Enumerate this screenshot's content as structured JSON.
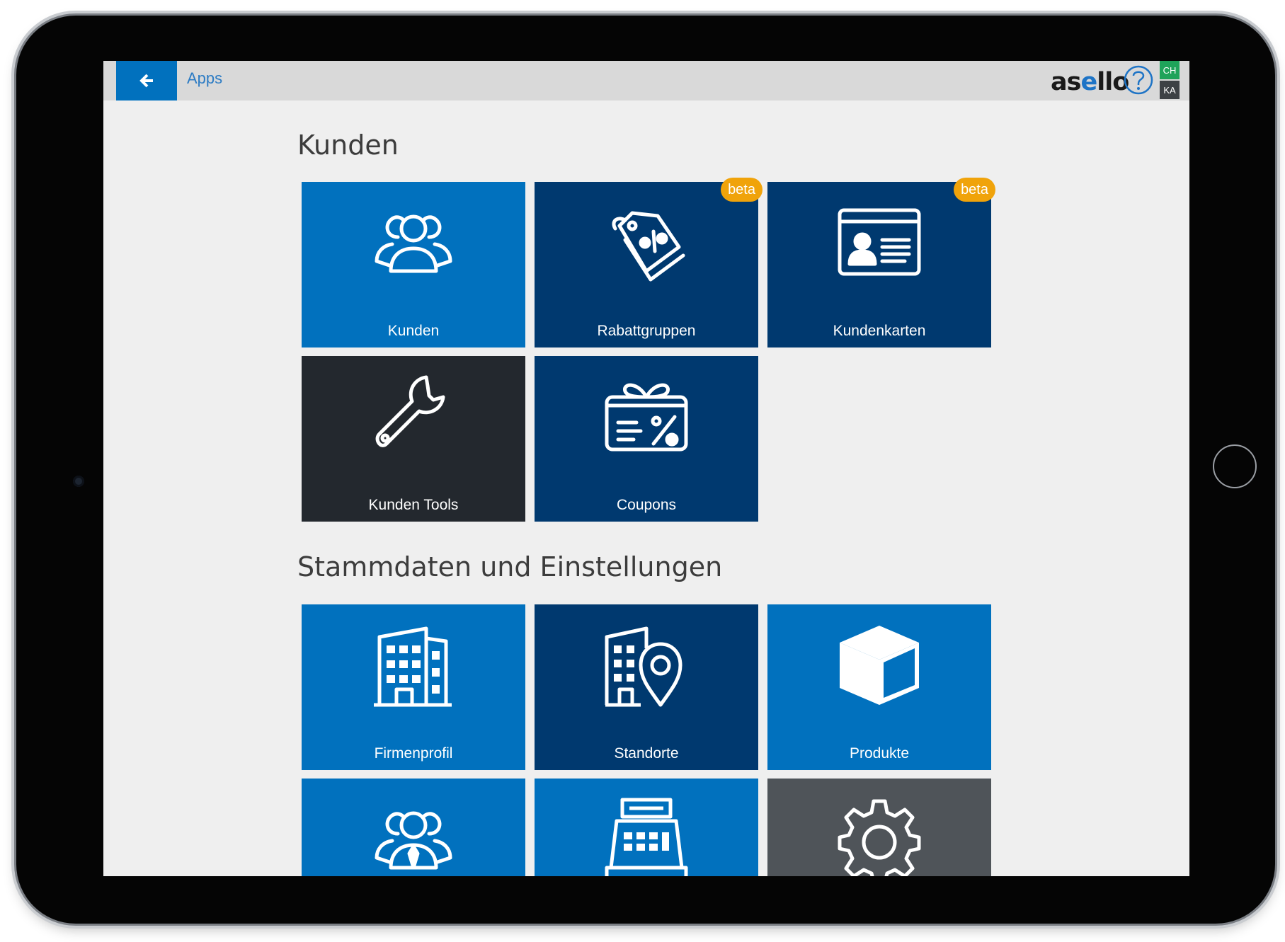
{
  "topbar": {
    "title": "Apps",
    "logo_prefix": "as",
    "logo_accent": "e",
    "logo_suffix": "llo",
    "region_tag": "CH",
    "user_tag": "KA"
  },
  "colors": {
    "primary_blue": "#0171be",
    "navy": "#00396f",
    "dark": "#23282e",
    "gray": "#4f5459",
    "beta_badge": "#f0a30a",
    "tag_green": "#1fa35a"
  },
  "sections": [
    {
      "title": "Kunden",
      "tiles": [
        {
          "label": "Kunden",
          "icon": "people-group-icon",
          "color": "#0171be"
        },
        {
          "label": "Rabattgruppen",
          "icon": "price-tags-icon",
          "color": "#00396f",
          "badge": "beta"
        },
        {
          "label": "Kundenkarten",
          "icon": "id-card-icon",
          "color": "#00396f",
          "badge": "beta"
        },
        {
          "label": "Kunden Tools",
          "icon": "wrench-icon",
          "color": "#23282e"
        },
        {
          "label": "Coupons",
          "icon": "gift-coupon-icon",
          "color": "#00396f"
        }
      ]
    },
    {
      "title": "Stammdaten und Einstellungen",
      "tiles": [
        {
          "label": "Firmenprofil",
          "icon": "office-building-icon",
          "color": "#0171be"
        },
        {
          "label": "Standorte",
          "icon": "building-location-pin-icon",
          "color": "#00396f"
        },
        {
          "label": "Produkte",
          "icon": "box-cube-icon",
          "color": "#0171be"
        },
        {
          "icon": "staff-people-icon",
          "color": "#0171be"
        },
        {
          "icon": "cash-register-icon",
          "color": "#0171be"
        },
        {
          "icon": "gear-icon",
          "color": "#4f5459"
        }
      ]
    }
  ]
}
